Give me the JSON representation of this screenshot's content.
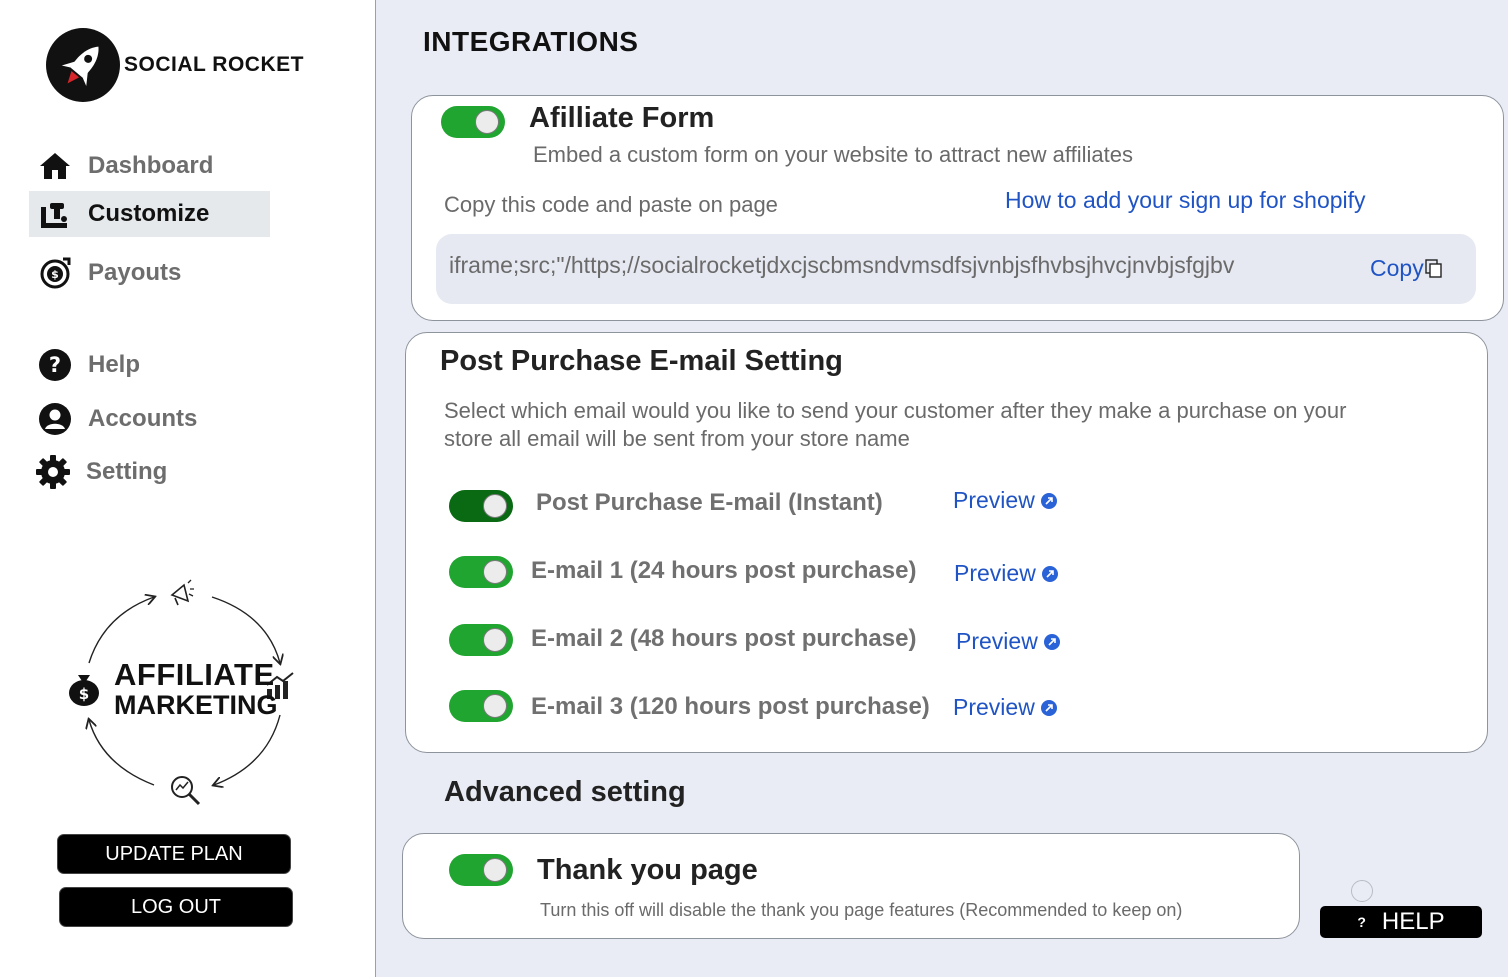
{
  "brand": {
    "name": "SOCIAL ROCKET"
  },
  "nav": [
    {
      "label": "Dashboard",
      "icon": "home-icon"
    },
    {
      "label": "Customize",
      "icon": "customize-icon",
      "active": true
    },
    {
      "label": "Payouts",
      "icon": "payouts-icon"
    },
    {
      "label": "Help",
      "icon": "question-icon"
    },
    {
      "label": "Accounts",
      "icon": "user-icon"
    },
    {
      "label": "Setting",
      "icon": "gear-icon"
    }
  ],
  "affiliate_graphic": {
    "line1": "AFFILIATE",
    "line2": "MARKETING"
  },
  "buttons": {
    "update_plan": "UPDATE PLAN",
    "log_out": "LOG OUT",
    "help": "HELP",
    "help_mark": "?"
  },
  "page": {
    "title": "INTEGRATIONS"
  },
  "affiliate_form": {
    "title": "Afilliate Form",
    "subtitle": "Embed a custom form on your website to attract new affiliates",
    "copy_prompt": "Copy this code and paste on page",
    "shopify_link": "How to add your sign up for shopify",
    "code": "iframe;src;\"/https;//socialrocketjdxcjscbmsndvmsdfsjvnbjsfhvbsjhvcjnvbjsfgjbv",
    "copy_label": "Copy",
    "enabled": true
  },
  "post_purchase": {
    "title": "Post Purchase E-mail Setting",
    "description_line1": "Select which email would you like to send your customer after they make a purchase on your",
    "description_line2": "store all email will be sent  from your store name",
    "emails": [
      {
        "label": "Post Purchase E-mail (Instant)",
        "preview": "Preview",
        "enabled": true
      },
      {
        "label": "E-mail 1 (24 hours post purchase)",
        "preview": "Preview",
        "enabled": true
      },
      {
        "label": "E-mail 2 (48 hours post purchase)",
        "preview": "Preview",
        "enabled": true
      },
      {
        "label": "E-mail 3 (120 hours post purchase)",
        "preview": "Preview",
        "enabled": true
      }
    ]
  },
  "advanced": {
    "title": "Advanced setting",
    "thank_you": {
      "title": "Thank you page",
      "note": "Turn this off will disable the thank you page features (Recommended to keep on)",
      "enabled": true
    }
  },
  "colors": {
    "toggle_on": "#20a530",
    "toggle_active": "#0a6a14",
    "link": "#2054c4",
    "background": "#e9ecf4"
  }
}
